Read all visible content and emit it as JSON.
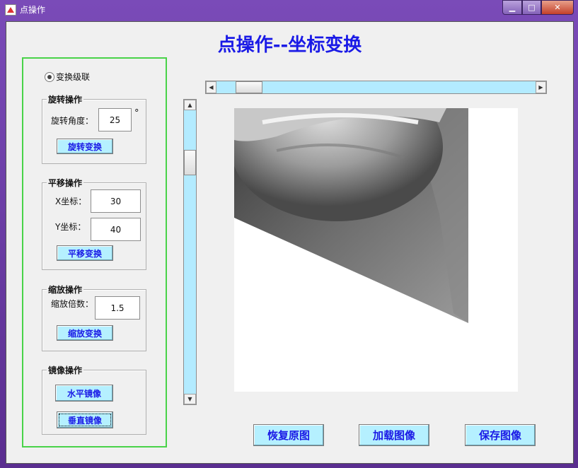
{
  "window": {
    "title": "点操作",
    "min_label": "▁",
    "max_label": "□",
    "close_label": "✕"
  },
  "header": {
    "title": "点操作--坐标变换"
  },
  "cascade": {
    "label": "变换级联",
    "checked": true
  },
  "rotate": {
    "group_title": "旋转操作",
    "angle_label": "旋转角度：",
    "angle_value": "25",
    "unit": "°",
    "button": "旋转变换"
  },
  "translate": {
    "group_title": "平移操作",
    "x_label": "X坐标：",
    "x_value": "30",
    "y_label": "Y坐标：",
    "y_value": "40",
    "button": "平移变换"
  },
  "scale": {
    "group_title": "缩放操作",
    "factor_label": "缩放倍数：",
    "factor_value": "1.5",
    "button": "缩放变换"
  },
  "mirror": {
    "group_title": "镜像操作",
    "h_button": "水平镜像",
    "v_button": "垂直镜像"
  },
  "actions": {
    "restore": "恢复原图",
    "load": "加载图像",
    "save": "保存图像"
  },
  "scrollbars": {
    "horizontal_position": 0.1,
    "vertical_position": 0.2
  }
}
